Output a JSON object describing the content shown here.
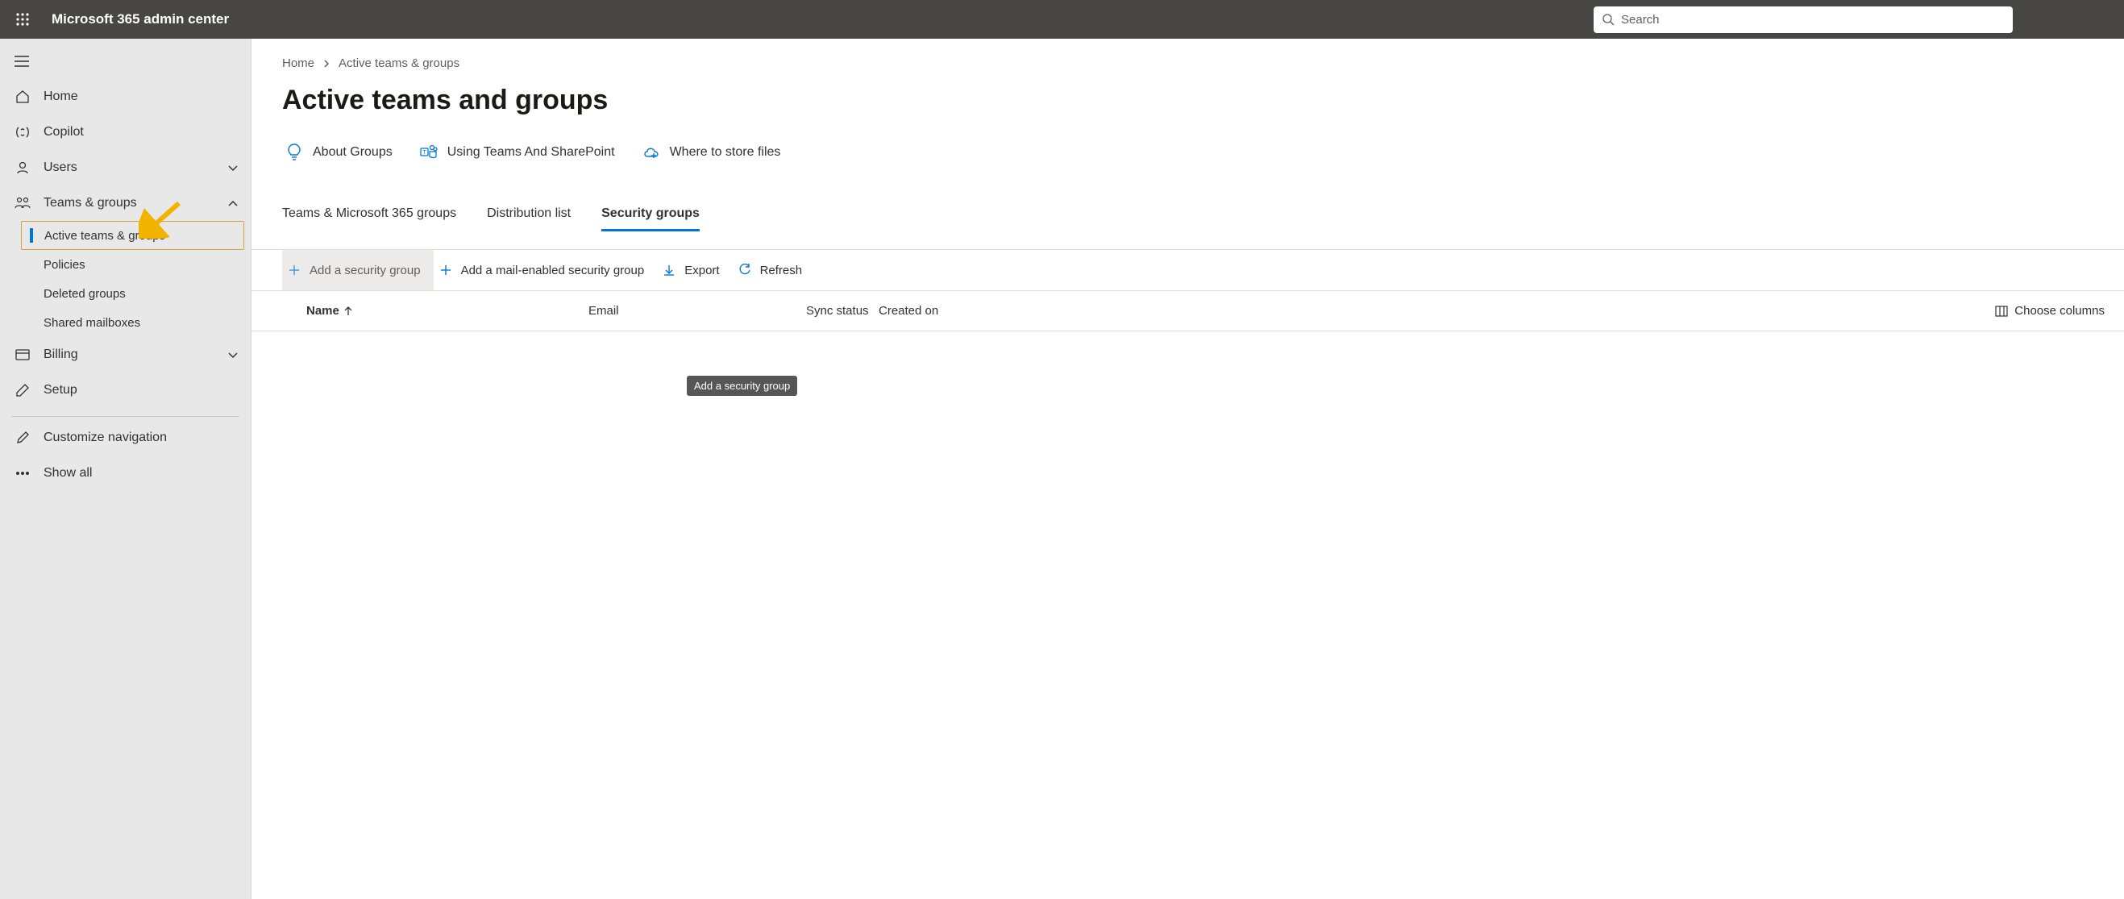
{
  "header": {
    "app_title": "Microsoft 365 admin center",
    "search_placeholder": "Search"
  },
  "sidebar": {
    "items": [
      {
        "icon": "home",
        "label": "Home"
      },
      {
        "icon": "copilot",
        "label": "Copilot"
      },
      {
        "icon": "users",
        "label": "Users",
        "expandable": true,
        "expanded": false
      },
      {
        "icon": "groups",
        "label": "Teams & groups",
        "expandable": true,
        "expanded": true
      },
      {
        "icon": "billing",
        "label": "Billing",
        "expandable": true,
        "expanded": false
      },
      {
        "icon": "setup",
        "label": "Setup"
      }
    ],
    "groups_children": [
      {
        "label": "Active teams & groups",
        "active": true
      },
      {
        "label": "Policies"
      },
      {
        "label": "Deleted groups"
      },
      {
        "label": "Shared mailboxes"
      }
    ],
    "footer": [
      {
        "icon": "customize",
        "label": "Customize navigation"
      },
      {
        "icon": "more",
        "label": "Show all"
      }
    ]
  },
  "breadcrumb": {
    "root": "Home",
    "current": "Active teams & groups"
  },
  "page_title": "Active teams and groups",
  "info_links": [
    {
      "label": "About Groups"
    },
    {
      "label": "Using Teams And SharePoint"
    },
    {
      "label": "Where to store files"
    }
  ],
  "tabs": [
    {
      "label": "Teams & Microsoft 365 groups",
      "active": false
    },
    {
      "label": "Distribution list",
      "active": false
    },
    {
      "label": "Security groups",
      "active": true
    }
  ],
  "commands": {
    "add_security": "Add a security group",
    "add_mail": "Add a mail-enabled security group",
    "export": "Export",
    "refresh": "Refresh"
  },
  "tooltip": "Add a security group",
  "columns": {
    "name": "Name",
    "email": "Email",
    "sync": "Sync status",
    "created": "Created on",
    "choose": "Choose columns"
  }
}
